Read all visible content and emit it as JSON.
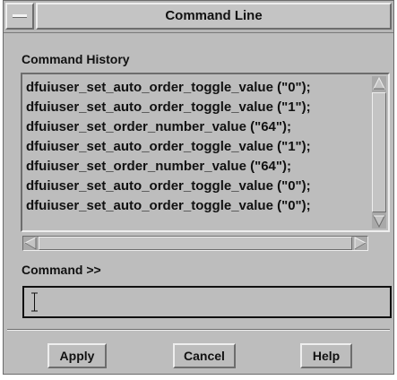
{
  "window": {
    "title": "Command Line"
  },
  "history": {
    "label": "Command History",
    "lines": [
      "dfuiuser_set_auto_order_toggle_value (\"0\");",
      "dfuiuser_set_auto_order_toggle_value (\"1\");",
      "dfuiuser_set_order_number_value (\"64\");",
      "dfuiuser_set_auto_order_toggle_value (\"1\");",
      "dfuiuser_set_order_number_value (\"64\");",
      "dfuiuser_set_auto_order_toggle_value (\"0\");",
      "dfuiuser_set_auto_order_toggle_value (\"0\");"
    ]
  },
  "command": {
    "label": "Command >>",
    "value": ""
  },
  "buttons": {
    "apply": "Apply",
    "cancel": "Cancel",
    "help": "Help"
  },
  "colors": {
    "background": "#bdbdbd",
    "highlight": "#eeeeee",
    "shadow": "#6d6d6d",
    "text": "#111111"
  },
  "icons": {
    "window_menu": "window-menu-icon",
    "scroll_up": "up-arrow-icon",
    "scroll_down": "down-arrow-icon",
    "scroll_left": "left-arrow-icon",
    "scroll_right": "right-arrow-icon",
    "text_cursor": "ibeam-cursor-icon"
  }
}
